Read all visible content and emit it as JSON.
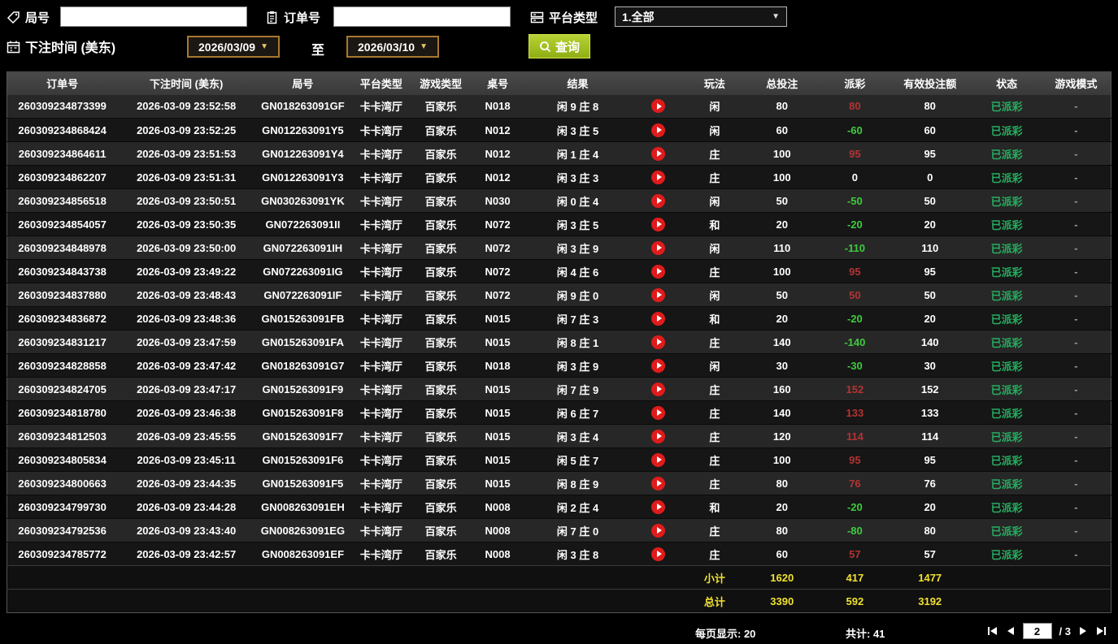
{
  "filters": {
    "round_label": "局号",
    "order_label": "订单号",
    "platform_label": "平台类型",
    "platform_value": "1.全部",
    "bet_time_label": "下注时间 (美东)",
    "date_from": "2026/03/09",
    "date_to": "2026/03/10",
    "to_label": "至",
    "query_label": "查询"
  },
  "icons": {
    "round_icon": "tag-icon",
    "order_icon": "clipboard-icon",
    "platform_icon": "list-icon",
    "bet_time_icon": "calendar-icon",
    "query_icon": "search-icon",
    "video_icon": "play-circle (red)",
    "pager_icons": [
      "first-page",
      "prev-page",
      "next-page",
      "last-page"
    ]
  },
  "colors": {
    "payout_positive": "#b53333",
    "payout_negative": "#3ecb3e",
    "status_paid": "#27ae60",
    "summary_text": "#f0e130",
    "query_button": "#9db421",
    "date_border": "#a87832",
    "video_button": "#e01b1b"
  },
  "table": {
    "headers": [
      "订单号",
      "下注时间 (美东)",
      "局号",
      "平台类型",
      "游戏类型",
      "桌号",
      "结果",
      "",
      "玩法",
      "总投注",
      "派彩",
      "有效投注额",
      "状态",
      "游戏模式"
    ],
    "rows": [
      {
        "order": "260309234873399",
        "time": "2026-03-09 23:52:58",
        "round": "GN018263091GF",
        "platform": "卡卡湾厅",
        "game": "百家乐",
        "table": "N018",
        "result": "闲 9 庄 8",
        "play": "闲",
        "total": "80",
        "payout": "80",
        "payout_class": "pos",
        "valid": "80",
        "status": "已派彩",
        "mode": "-"
      },
      {
        "order": "260309234868424",
        "time": "2026-03-09 23:52:25",
        "round": "GN012263091Y5",
        "platform": "卡卡湾厅",
        "game": "百家乐",
        "table": "N012",
        "result": "闲 3 庄 5",
        "play": "闲",
        "total": "60",
        "payout": "-60",
        "payout_class": "neg",
        "valid": "60",
        "status": "已派彩",
        "mode": "-"
      },
      {
        "order": "260309234864611",
        "time": "2026-03-09 23:51:53",
        "round": "GN012263091Y4",
        "platform": "卡卡湾厅",
        "game": "百家乐",
        "table": "N012",
        "result": "闲 1 庄 4",
        "play": "庄",
        "total": "100",
        "payout": "95",
        "payout_class": "pos",
        "valid": "95",
        "status": "已派彩",
        "mode": "-"
      },
      {
        "order": "260309234862207",
        "time": "2026-03-09 23:51:31",
        "round": "GN012263091Y3",
        "platform": "卡卡湾厅",
        "game": "百家乐",
        "table": "N012",
        "result": "闲 3 庄 3",
        "play": "庄",
        "total": "100",
        "payout": "0",
        "payout_class": "zero",
        "valid": "0",
        "status": "已派彩",
        "mode": "-"
      },
      {
        "order": "260309234856518",
        "time": "2026-03-09 23:50:51",
        "round": "GN030263091YK",
        "platform": "卡卡湾厅",
        "game": "百家乐",
        "table": "N030",
        "result": "闲 0 庄 4",
        "play": "闲",
        "total": "50",
        "payout": "-50",
        "payout_class": "neg",
        "valid": "50",
        "status": "已派彩",
        "mode": "-"
      },
      {
        "order": "260309234854057",
        "time": "2026-03-09 23:50:35",
        "round": "GN072263091II",
        "platform": "卡卡湾厅",
        "game": "百家乐",
        "table": "N072",
        "result": "闲 3 庄 5",
        "play": "和",
        "total": "20",
        "payout": "-20",
        "payout_class": "neg",
        "valid": "20",
        "status": "已派彩",
        "mode": "-"
      },
      {
        "order": "260309234848978",
        "time": "2026-03-09 23:50:00",
        "round": "GN072263091IH",
        "platform": "卡卡湾厅",
        "game": "百家乐",
        "table": "N072",
        "result": "闲 3 庄 9",
        "play": "闲",
        "total": "110",
        "payout": "-110",
        "payout_class": "neg",
        "valid": "110",
        "status": "已派彩",
        "mode": "-"
      },
      {
        "order": "260309234843738",
        "time": "2026-03-09 23:49:22",
        "round": "GN072263091IG",
        "platform": "卡卡湾厅",
        "game": "百家乐",
        "table": "N072",
        "result": "闲 4 庄 6",
        "play": "庄",
        "total": "100",
        "payout": "95",
        "payout_class": "pos",
        "valid": "95",
        "status": "已派彩",
        "mode": "-"
      },
      {
        "order": "260309234837880",
        "time": "2026-03-09 23:48:43",
        "round": "GN072263091IF",
        "platform": "卡卡湾厅",
        "game": "百家乐",
        "table": "N072",
        "result": "闲 9 庄 0",
        "play": "闲",
        "total": "50",
        "payout": "50",
        "payout_class": "pos",
        "valid": "50",
        "status": "已派彩",
        "mode": "-"
      },
      {
        "order": "260309234836872",
        "time": "2026-03-09 23:48:36",
        "round": "GN015263091FB",
        "platform": "卡卡湾厅",
        "game": "百家乐",
        "table": "N015",
        "result": "闲 7 庄 3",
        "play": "和",
        "total": "20",
        "payout": "-20",
        "payout_class": "neg",
        "valid": "20",
        "status": "已派彩",
        "mode": "-"
      },
      {
        "order": "260309234831217",
        "time": "2026-03-09 23:47:59",
        "round": "GN015263091FA",
        "platform": "卡卡湾厅",
        "game": "百家乐",
        "table": "N015",
        "result": "闲 8 庄 1",
        "play": "庄",
        "total": "140",
        "payout": "-140",
        "payout_class": "neg",
        "valid": "140",
        "status": "已派彩",
        "mode": "-"
      },
      {
        "order": "260309234828858",
        "time": "2026-03-09 23:47:42",
        "round": "GN018263091G7",
        "platform": "卡卡湾厅",
        "game": "百家乐",
        "table": "N018",
        "result": "闲 3 庄 9",
        "play": "闲",
        "total": "30",
        "payout": "-30",
        "payout_class": "neg",
        "valid": "30",
        "status": "已派彩",
        "mode": "-"
      },
      {
        "order": "260309234824705",
        "time": "2026-03-09 23:47:17",
        "round": "GN015263091F9",
        "platform": "卡卡湾厅",
        "game": "百家乐",
        "table": "N015",
        "result": "闲 7 庄 9",
        "play": "庄",
        "total": "160",
        "payout": "152",
        "payout_class": "pos",
        "valid": "152",
        "status": "已派彩",
        "mode": "-"
      },
      {
        "order": "260309234818780",
        "time": "2026-03-09 23:46:38",
        "round": "GN015263091F8",
        "platform": "卡卡湾厅",
        "game": "百家乐",
        "table": "N015",
        "result": "闲 6 庄 7",
        "play": "庄",
        "total": "140",
        "payout": "133",
        "payout_class": "pos",
        "valid": "133",
        "status": "已派彩",
        "mode": "-"
      },
      {
        "order": "260309234812503",
        "time": "2026-03-09 23:45:55",
        "round": "GN015263091F7",
        "platform": "卡卡湾厅",
        "game": "百家乐",
        "table": "N015",
        "result": "闲 3 庄 4",
        "play": "庄",
        "total": "120",
        "payout": "114",
        "payout_class": "pos",
        "valid": "114",
        "status": "已派彩",
        "mode": "-"
      },
      {
        "order": "260309234805834",
        "time": "2026-03-09 23:45:11",
        "round": "GN015263091F6",
        "platform": "卡卡湾厅",
        "game": "百家乐",
        "table": "N015",
        "result": "闲 5 庄 7",
        "play": "庄",
        "total": "100",
        "payout": "95",
        "payout_class": "pos",
        "valid": "95",
        "status": "已派彩",
        "mode": "-"
      },
      {
        "order": "260309234800663",
        "time": "2026-03-09 23:44:35",
        "round": "GN015263091F5",
        "platform": "卡卡湾厅",
        "game": "百家乐",
        "table": "N015",
        "result": "闲 8 庄 9",
        "play": "庄",
        "total": "80",
        "payout": "76",
        "payout_class": "pos",
        "valid": "76",
        "status": "已派彩",
        "mode": "-"
      },
      {
        "order": "260309234799730",
        "time": "2026-03-09 23:44:28",
        "round": "GN008263091EH",
        "platform": "卡卡湾厅",
        "game": "百家乐",
        "table": "N008",
        "result": "闲 2 庄 4",
        "play": "和",
        "total": "20",
        "payout": "-20",
        "payout_class": "neg",
        "valid": "20",
        "status": "已派彩",
        "mode": "-"
      },
      {
        "order": "260309234792536",
        "time": "2026-03-09 23:43:40",
        "round": "GN008263091EG",
        "platform": "卡卡湾厅",
        "game": "百家乐",
        "table": "N008",
        "result": "闲 7 庄 0",
        "play": "庄",
        "total": "80",
        "payout": "-80",
        "payout_class": "neg",
        "valid": "80",
        "status": "已派彩",
        "mode": "-"
      },
      {
        "order": "260309234785772",
        "time": "2026-03-09 23:42:57",
        "round": "GN008263091EF",
        "platform": "卡卡湾厅",
        "game": "百家乐",
        "table": "N008",
        "result": "闲 3 庄 8",
        "play": "庄",
        "total": "60",
        "payout": "57",
        "payout_class": "pos",
        "valid": "57",
        "status": "已派彩",
        "mode": "-"
      }
    ],
    "subtotal": {
      "label": "小计",
      "total_bet": "1620",
      "payout": "417",
      "valid_bet": "1477"
    },
    "total": {
      "label": "总计",
      "total_bet": "3390",
      "payout": "592",
      "valid_bet": "3192"
    }
  },
  "pagination": {
    "per_page_label": "每页显示: 20",
    "total_label": "共计: 41",
    "current_page": "2",
    "page_total": "/ 3"
  }
}
